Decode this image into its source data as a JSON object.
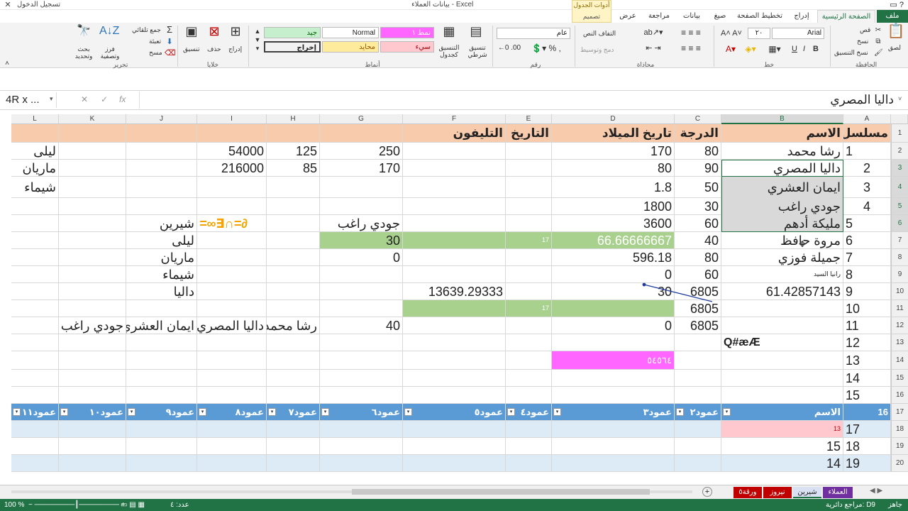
{
  "titlebar": {
    "title": "بيانات العملاء - Excel",
    "signin": "تسجيل الدخول",
    "tool_context": "أدوات الجدول",
    "tool_tab": "تصميم"
  },
  "tabs": [
    "ملف",
    "الصفحة الرئيسية",
    "إدراج",
    "تخطيط الصفحة",
    "صيغ",
    "بيانات",
    "مراجعة",
    "عرض"
  ],
  "ribbon": {
    "clipboard": {
      "label": "الحافظة",
      "paste": "لصق",
      "cut": "قص",
      "copy": "نسخ",
      "format_painter": "نسخ التنسيق"
    },
    "font": {
      "label": "خط",
      "name": "Arial",
      "size": "٢٠",
      "bold": "B",
      "italic": "I",
      "underline": "U"
    },
    "alignment": {
      "label": "محاذاة",
      "wrap": "التفاف النص",
      "merge": "دمج وتوسيط"
    },
    "number": {
      "label": "رقم",
      "format": "عام",
      "percent": "%"
    },
    "styles": {
      "label": "أنماط",
      "conditional": "تنسيق شرطي",
      "format_table": "التنسيق كجدول",
      "normal": "Normal",
      "good": "جيد",
      "neutral": "محايد",
      "bad": "سيء",
      "output": "إخراج",
      "style1": "نمط ١"
    },
    "cells": {
      "label": "خلايا",
      "insert": "إدراج",
      "delete": "حذف",
      "format": "تنسيق"
    },
    "editing": {
      "label": "تحرير",
      "autosum": "جمع تلقائي",
      "fill": "تعبئة",
      "clear": "مسح",
      "sort": "فرز وتصفية",
      "find": "بحث وتحديد"
    }
  },
  "formula_bar": {
    "name_box": "4R x ...",
    "value": "داليا المصري"
  },
  "columns": [
    "A",
    "B",
    "C",
    "D",
    "E",
    "F",
    "G",
    "H",
    "I",
    "J",
    "K",
    "L"
  ],
  "rows": [
    "1",
    "2",
    "3",
    "4",
    "5",
    "6",
    "7",
    "8",
    "9",
    "10",
    "11",
    "12",
    "13",
    "14",
    "15",
    "16",
    "17",
    "18",
    "19",
    "20"
  ],
  "cells": {
    "A1": "مسلسل",
    "B1": "الاسم",
    "C1": "الدرجة",
    "D1": "تاريخ الميلاد",
    "E1": "التاريخ",
    "F1": "التليفون",
    "A2": "1",
    "B2": "رشا محمد",
    "C2": "80",
    "D2": "170",
    "G2": "250",
    "H2": "125",
    "I2": "54000",
    "L2": "ليلى",
    "A3": "2",
    "B3": "داليا المصري",
    "C3": "90",
    "D3": "80",
    "G3": "170",
    "H3": "85",
    "I3": "216000",
    "L3": "ماريان",
    "A4": "3",
    "B4": "ايمان العشري",
    "C4": "50",
    "D4": "1.8",
    "L4": "شيماء",
    "A5": "4",
    "B5": "جودي راغب",
    "C5": "30",
    "D5": "1800",
    "A6": "5",
    "B6": "مليكة أدهم",
    "C6": "60",
    "D6": "3600",
    "G6": "جودي راغب",
    "J6": "شيرين",
    "I6": "=∞∃∩=∂",
    "A7": "6",
    "B7": "مروة حافظ",
    "C7": "40",
    "D7": "66.66666667",
    "E7": "17",
    "G7": "30",
    "J7": "ليلى",
    "A8": "7",
    "B8": "جميلة فوزي",
    "C8": "80",
    "D8": "596.18",
    "G8": "0",
    "J8": "ماريان",
    "A9": "8",
    "B9": "رانيا السيد",
    "C9": "60",
    "D9": "0",
    "J9": "شيماء",
    "A10": "9",
    "B10": "61.42857143",
    "C10": "6805",
    "D10": "30",
    "F10": "13639.29333",
    "J10": "داليا",
    "A11": "10",
    "C11": "6805",
    "E11": "17",
    "A12": "11",
    "C12": "6805",
    "D12": "0",
    "G12": "40",
    "H12": "رشا محمد",
    "I12": "داليا المصري",
    "J12": "ايمان العشري",
    "K12": "جودي راغب",
    "A13": "12",
    "B13": "Q#æÆ",
    "A14": "13",
    "D14": "٥٤٥٦٤",
    "A15": "14",
    "A16": "15",
    "A17": "16",
    "B17": "الاسم",
    "C17": "عمود٢",
    "D17": "عمود٣",
    "E17": "عمود٤",
    "F17": "عمود٥",
    "G17": "عمود٦",
    "H17": "عمود٧",
    "I17": "عمود٨",
    "J17": "عمود٩",
    "K17": "عمود١٠",
    "L17": "عمود١١",
    "A18": "17",
    "B18": "13",
    "A19": "18",
    "B19": "15",
    "A20": "19",
    "B20": "14"
  },
  "sheets": [
    "العملاء",
    "شيرين",
    "نيروز",
    "ورقة٥"
  ],
  "status": {
    "ready": "جاهز",
    "circular": "مراجع دائرية: D9",
    "count": "عدد: ٤",
    "zoom": "100 %"
  },
  "colors": {
    "excel_green": "#217346",
    "header_fill": "#f8cbad",
    "green_fill": "#a9d18e",
    "pink_fill": "#ff66ff",
    "table_header": "#5b9bd5",
    "table_band": "#ddebf7",
    "bad_fill": "#ffc7ce",
    "good_fill": "#c6efce",
    "neutral_fill": "#ffeb9c"
  }
}
